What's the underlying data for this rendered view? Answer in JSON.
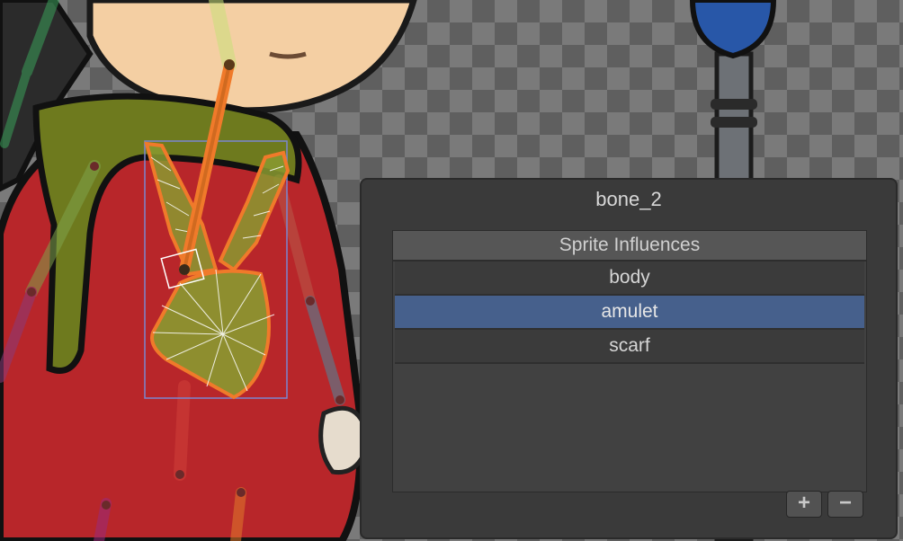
{
  "panel": {
    "title": "bone_2",
    "list_header": "Sprite Influences",
    "items": [
      {
        "label": "body",
        "selected": false
      },
      {
        "label": "amulet",
        "selected": true
      },
      {
        "label": "scarf",
        "selected": false
      }
    ],
    "add_button": "+",
    "remove_button": "−"
  },
  "colors": {
    "selection": "#46608c",
    "bone_highlight": "#f07a2a",
    "mesh_fill": "#8a9a30",
    "coat_red": "#b8262a",
    "scarf_green": "#6e7a1e"
  }
}
